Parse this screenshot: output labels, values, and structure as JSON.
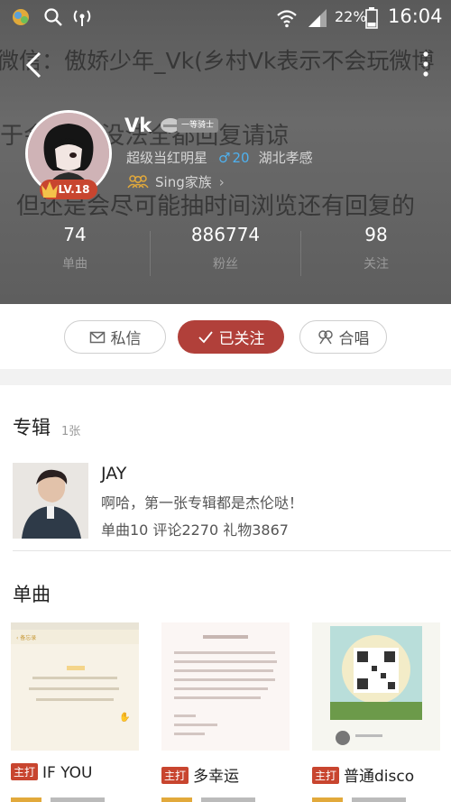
{
  "status_bar": {
    "battery": "22%",
    "time": "16:04"
  },
  "background_text": {
    "line1": "微信：傲娇少年_Vk(乡村Vk表示不会玩微博",
    "line2": "于会 太多没法全都回复请谅",
    "line3": "但还是会尽可能抽时间浏览还有回复的"
  },
  "profile": {
    "name": "Vk",
    "rank_badge": "一等骑士",
    "level": "LV.18",
    "title": "超级当红明星",
    "gender_symbol": "♂",
    "age": "20",
    "location": "湖北孝感",
    "family": "Sing家族"
  },
  "stats": [
    {
      "value": "74",
      "label": "单曲"
    },
    {
      "value": "886774",
      "label": "粉丝"
    },
    {
      "value": "98",
      "label": "关注"
    }
  ],
  "actions": {
    "message": "私信",
    "follow": "已关注",
    "duet": "合唱"
  },
  "album": {
    "section_title": "专辑",
    "count": "1张",
    "name": "JAY",
    "desc": "啊哈，第一张专辑都是杰伦哒！",
    "stats": "单曲10 评论2270 礼物3867"
  },
  "singles": {
    "section_title": "单曲",
    "tag": "主打",
    "items": [
      {
        "title": "IF YOU"
      },
      {
        "title": "多幸运"
      },
      {
        "title": "普通disco"
      }
    ]
  },
  "colors": {
    "accent": "#b1403a",
    "tag": "#c8452f",
    "male": "#4fb1ee"
  }
}
